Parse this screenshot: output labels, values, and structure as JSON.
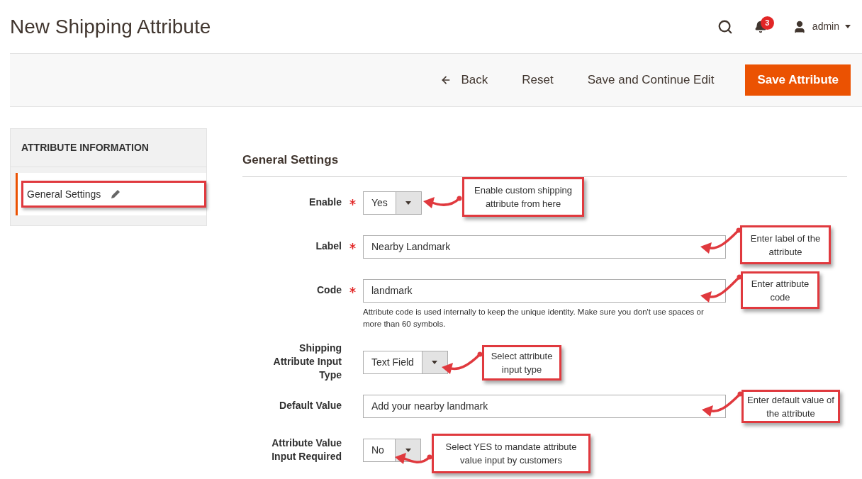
{
  "page_title": "New Shipping Attribute",
  "header": {
    "notifications": "3",
    "user": "admin"
  },
  "toolbar": [
    {
      "kind": "back",
      "label": "Back"
    },
    {
      "kind": "link",
      "label": "Reset"
    },
    {
      "kind": "link",
      "label": "Save and Continue Edit"
    },
    {
      "kind": "primary",
      "label": "Save Attribute"
    }
  ],
  "sidebar": {
    "title": "ATTRIBUTE INFORMATION",
    "items": [
      {
        "label": "General Settings",
        "selected": true
      }
    ]
  },
  "section_title": "General Settings",
  "fields": [
    {
      "kind": "select",
      "label": "Enable",
      "required": true,
      "value": "Yes"
    },
    {
      "kind": "text",
      "label": "Label",
      "required": true,
      "value": "Nearby Landmark"
    },
    {
      "kind": "text",
      "label": "Code",
      "required": true,
      "value": "landmark",
      "note": "Attribute code is used internally to keep the unique identity. Make sure you don't use spaces or more than 60 symbols."
    },
    {
      "kind": "select",
      "label": "Shipping Attribute Input Type",
      "required": false,
      "value": "Text Field"
    },
    {
      "kind": "text",
      "label": "Default Value",
      "required": false,
      "value": "Add your nearby landmark"
    },
    {
      "kind": "select",
      "label": "Attribute Value Input Required",
      "required": false,
      "value": "No"
    }
  ],
  "annotations": [
    {
      "text": "Enable custom shipping attribute from here"
    },
    {
      "text": "Enter label of the attribute"
    },
    {
      "text": "Enter attribute code"
    },
    {
      "text": "Select attribute input type"
    },
    {
      "text": "Enter default value of the attribute"
    },
    {
      "text": "Select YES to mandate attribute value input by customers"
    }
  ]
}
